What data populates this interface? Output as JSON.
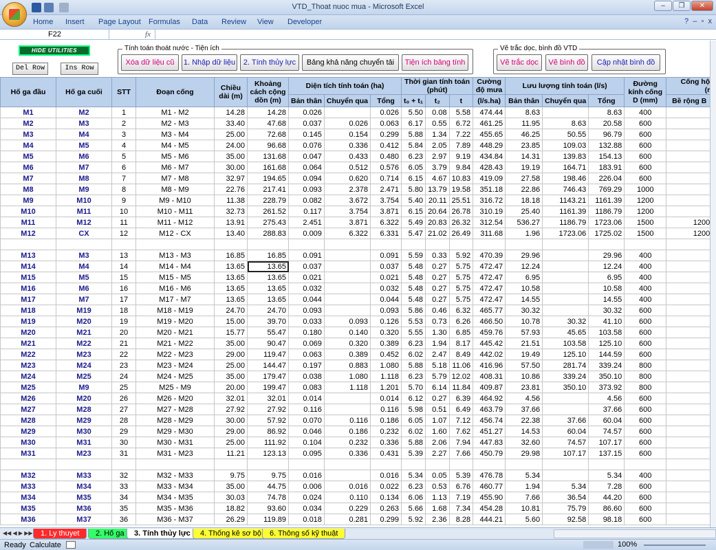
{
  "window": {
    "title": "VTD_Thoat nuoc mua - Microsoft Excel"
  },
  "ribbon": {
    "tabs": [
      "Home",
      "Insert",
      "Page Layout",
      "Formulas",
      "Data",
      "Review",
      "View",
      "Developer"
    ]
  },
  "formula": {
    "cell": "F22",
    "fx": "fx"
  },
  "utilities": {
    "hide_label": "HIDE UTILITIES",
    "del_row": "Del Row",
    "ins_row": "Ins Row",
    "group1_label": "Tính toán thoát nước - Tiện ích",
    "group1_buttons": [
      "Xóa dữ liệu cũ",
      "1. Nhập dữ liệu",
      "2. Tính thủy lực",
      "Bảng khả năng chuyển tải",
      "Tiện ích bảng tính"
    ],
    "group2_label": "Vẽ trắc dọc, bình đồ VTD",
    "group2_buttons": [
      "Vẽ trắc dọc",
      "Vẽ bình đồ",
      "Cập nhật bình đồ"
    ],
    "button_colors": [
      "#d4007a",
      "#1a1ab8",
      "#1a1ab8",
      "#000000",
      "#d4007a",
      "#d4007a",
      "#d4007a",
      "#1a1ab8"
    ]
  },
  "header": {
    "h1": "Hố ga đầu",
    "h2": "Hố ga cuối",
    "h3": "STT",
    "h4": "Đoạn cống",
    "h5": "Chiều dài (m)",
    "h6": "Khoảng cách cộng dồn (m)",
    "area": "Diện tích tính toán (ha)",
    "area_sub": [
      "Bản thân",
      "Chuyển qua",
      "Tổng"
    ],
    "time": "Thời gian tính toán (phút)",
    "time_sub": [
      "t₀ + t₁",
      "t₂",
      "t"
    ],
    "intensity": "Cường độ mưa",
    "intensity_unit": "(l/s.ha)",
    "flow": "Lưu lượng tính toán (l/s)",
    "flow_sub": [
      "Bản thân",
      "Chuyển qua",
      "Tổng"
    ],
    "diam": "Đường kính cống D (mm)",
    "box": "Cống hộ",
    "box_unit": "(r",
    "box_sub": "Bề rộng B"
  },
  "rows": [
    [
      "M1",
      "M2",
      "1",
      "M1 - M2",
      "14.28",
      "14.28",
      "0.026",
      "",
      "0.026",
      "5.50",
      "0.08",
      "5.58",
      "474.44",
      "8.63",
      "",
      "8.63",
      "400",
      ""
    ],
    [
      "M2",
      "M3",
      "2",
      "M2 - M3",
      "33.40",
      "47.68",
      "0.037",
      "0.026",
      "0.063",
      "6.17",
      "0.55",
      "6.72",
      "461.25",
      "11.95",
      "8.63",
      "20.58",
      "600",
      ""
    ],
    [
      "M3",
      "M4",
      "3",
      "M3 - M4",
      "25.00",
      "72.68",
      "0.145",
      "0.154",
      "0.299",
      "5.88",
      "1.34",
      "7.22",
      "455.65",
      "46.25",
      "50.55",
      "96.79",
      "600",
      ""
    ],
    [
      "M4",
      "M5",
      "4",
      "M4 - M5",
      "24.00",
      "96.68",
      "0.076",
      "0.336",
      "0.412",
      "5.84",
      "2.05",
      "7.89",
      "448.29",
      "23.85",
      "109.03",
      "132.88",
      "600",
      ""
    ],
    [
      "M5",
      "M6",
      "5",
      "M5 - M6",
      "35.00",
      "131.68",
      "0.047",
      "0.433",
      "0.480",
      "6.23",
      "2.97",
      "9.19",
      "434.84",
      "14.31",
      "139.83",
      "154.13",
      "600",
      ""
    ],
    [
      "M6",
      "M7",
      "6",
      "M6 - M7",
      "30.00",
      "161.68",
      "0.064",
      "0.512",
      "0.576",
      "6.05",
      "3.79",
      "9.84",
      "428.43",
      "19.19",
      "164.71",
      "183.91",
      "600",
      ""
    ],
    [
      "M7",
      "M8",
      "7",
      "M7 - M8",
      "32.97",
      "194.65",
      "0.094",
      "0.620",
      "0.714",
      "6.15",
      "4.67",
      "10.83",
      "419.09",
      "27.58",
      "198.46",
      "226.04",
      "600",
      ""
    ],
    [
      "M8",
      "M9",
      "8",
      "M8 - M9",
      "22.76",
      "217.41",
      "0.093",
      "2.378",
      "2.471",
      "5.80",
      "13.79",
      "19.58",
      "351.18",
      "22.86",
      "746.43",
      "769.29",
      "1000",
      ""
    ],
    [
      "M9",
      "M10",
      "9",
      "M9 - M10",
      "11.38",
      "228.79",
      "0.082",
      "3.672",
      "3.754",
      "5.40",
      "20.11",
      "25.51",
      "316.72",
      "18.18",
      "1143.21",
      "1161.39",
      "1200",
      ""
    ],
    [
      "M10",
      "M11",
      "10",
      "M10 - M11",
      "32.73",
      "261.52",
      "0.117",
      "3.754",
      "3.871",
      "6.15",
      "20.64",
      "26.78",
      "310.19",
      "25.40",
      "1161.39",
      "1186.79",
      "1200",
      ""
    ],
    [
      "M11",
      "M12",
      "11",
      "M11 - M12",
      "13.91",
      "275.43",
      "2.451",
      "3.871",
      "6.322",
      "5.49",
      "20.83",
      "26.32",
      "312.54",
      "536.27",
      "1186.79",
      "1723.06",
      "1500",
      "1200"
    ],
    [
      "M12",
      "CX",
      "12",
      "M12 - CX",
      "13.40",
      "288.83",
      "0.009",
      "6.322",
      "6.331",
      "5.47",
      "21.02",
      "26.49",
      "311.68",
      "1.96",
      "1723.06",
      "1725.02",
      "1500",
      "1200"
    ],
    [
      "",
      "",
      "",
      "",
      "",
      "",
      "",
      "",
      "",
      "",
      "",
      "",
      "",
      "",
      "",
      "",
      "",
      ""
    ],
    [
      "M13",
      "M3",
      "13",
      "M13 - M3",
      "16.85",
      "16.85",
      "0.091",
      "",
      "0.091",
      "5.59",
      "0.33",
      "5.92",
      "470.39",
      "29.96",
      "",
      "29.96",
      "400",
      ""
    ],
    [
      "M14",
      "M4",
      "14",
      "M14 - M4",
      "13.65",
      "13.65",
      "0.037",
      "",
      "0.037",
      "5.48",
      "0.27",
      "5.75",
      "472.47",
      "12.24",
      "",
      "12.24",
      "400",
      ""
    ],
    [
      "M15",
      "M5",
      "15",
      "M15 - M5",
      "13.65",
      "13.65",
      "0.021",
      "",
      "0.021",
      "5.48",
      "0.27",
      "5.75",
      "472.47",
      "6.95",
      "",
      "6.95",
      "400",
      ""
    ],
    [
      "M16",
      "M6",
      "16",
      "M16 - M6",
      "13.65",
      "13.65",
      "0.032",
      "",
      "0.032",
      "5.48",
      "0.27",
      "5.75",
      "472.47",
      "10.58",
      "",
      "10.58",
      "400",
      ""
    ],
    [
      "M17",
      "M7",
      "17",
      "M17 - M7",
      "13.65",
      "13.65",
      "0.044",
      "",
      "0.044",
      "5.48",
      "0.27",
      "5.75",
      "472.47",
      "14.55",
      "",
      "14.55",
      "400",
      ""
    ],
    [
      "M18",
      "M19",
      "18",
      "M18 - M19",
      "24.70",
      "24.70",
      "0.093",
      "",
      "0.093",
      "5.86",
      "0.46",
      "6.32",
      "465.77",
      "30.32",
      "",
      "30.32",
      "600",
      ""
    ],
    [
      "M19",
      "M20",
      "19",
      "M19 - M20",
      "15.00",
      "39.70",
      "0.033",
      "0.093",
      "0.126",
      "5.53",
      "0.73",
      "6.26",
      "466.50",
      "10.78",
      "30.32",
      "41.10",
      "600",
      ""
    ],
    [
      "M20",
      "M21",
      "20",
      "M20 - M21",
      "15.77",
      "55.47",
      "0.180",
      "0.140",
      "0.320",
      "5.55",
      "1.30",
      "6.85",
      "459.76",
      "57.93",
      "45.65",
      "103.58",
      "600",
      ""
    ],
    [
      "M21",
      "M22",
      "21",
      "M21 - M22",
      "35.00",
      "90.47",
      "0.069",
      "0.320",
      "0.389",
      "6.23",
      "1.94",
      "8.17",
      "445.42",
      "21.51",
      "103.58",
      "125.10",
      "600",
      ""
    ],
    [
      "M22",
      "M23",
      "22",
      "M22 - M23",
      "29.00",
      "119.47",
      "0.063",
      "0.389",
      "0.452",
      "6.02",
      "2.47",
      "8.49",
      "442.02",
      "19.49",
      "125.10",
      "144.59",
      "600",
      ""
    ],
    [
      "M23",
      "M24",
      "23",
      "M23 - M24",
      "25.00",
      "144.47",
      "0.197",
      "0.883",
      "1.080",
      "5.88",
      "5.18",
      "11.06",
      "416.96",
      "57.50",
      "281.74",
      "339.24",
      "800",
      ""
    ],
    [
      "M24",
      "M25",
      "24",
      "M24 - M25",
      "35.00",
      "179.47",
      "0.038",
      "1.080",
      "1.118",
      "6.23",
      "5.79",
      "12.02",
      "408.31",
      "10.86",
      "339.24",
      "350.10",
      "800",
      ""
    ],
    [
      "M25",
      "M9",
      "25",
      "M25 - M9",
      "20.00",
      "199.47",
      "0.083",
      "1.118",
      "1.201",
      "5.70",
      "6.14",
      "11.84",
      "409.87",
      "23.81",
      "350.10",
      "373.92",
      "800",
      ""
    ],
    [
      "M26",
      "M20",
      "26",
      "M26 - M20",
      "32.01",
      "32.01",
      "0.014",
      "",
      "0.014",
      "6.12",
      "0.27",
      "6.39",
      "464.92",
      "4.56",
      "",
      "4.56",
      "600",
      ""
    ],
    [
      "M27",
      "M28",
      "27",
      "M27 - M28",
      "27.92",
      "27.92",
      "0.116",
      "",
      "0.116",
      "5.98",
      "0.51",
      "6.49",
      "463.79",
      "37.66",
      "",
      "37.66",
      "600",
      ""
    ],
    [
      "M28",
      "M29",
      "28",
      "M28 - M29",
      "30.00",
      "57.92",
      "0.070",
      "0.116",
      "0.186",
      "6.05",
      "1.07",
      "7.12",
      "456.74",
      "22.38",
      "37.66",
      "60.04",
      "600",
      ""
    ],
    [
      "M29",
      "M30",
      "29",
      "M29 - M30",
      "29.00",
      "86.92",
      "0.046",
      "0.186",
      "0.232",
      "6.02",
      "1.60",
      "7.62",
      "451.27",
      "14.53",
      "60.04",
      "74.57",
      "600",
      ""
    ],
    [
      "M30",
      "M31",
      "30",
      "M30 - M31",
      "25.00",
      "111.92",
      "0.104",
      "0.232",
      "0.336",
      "5.88",
      "2.06",
      "7.94",
      "447.83",
      "32.60",
      "74.57",
      "107.17",
      "600",
      ""
    ],
    [
      "M31",
      "M23",
      "31",
      "M31 - M23",
      "11.21",
      "123.13",
      "0.095",
      "0.336",
      "0.431",
      "5.39",
      "2.27",
      "7.66",
      "450.79",
      "29.98",
      "107.17",
      "137.15",
      "600",
      ""
    ],
    [
      "",
      "",
      "",
      "",
      "",
      "",
      "",
      "",
      "",
      "",
      "",
      "",
      "",
      "",
      "",
      "",
      "",
      ""
    ],
    [
      "M32",
      "M33",
      "32",
      "M32 - M33",
      "9.75",
      "9.75",
      "0.016",
      "",
      "0.016",
      "5.34",
      "0.05",
      "5.39",
      "476.78",
      "5.34",
      "",
      "5.34",
      "400",
      ""
    ],
    [
      "M33",
      "M34",
      "33",
      "M33 - M34",
      "35.00",
      "44.75",
      "0.006",
      "0.016",
      "0.022",
      "6.23",
      "0.53",
      "6.76",
      "460.77",
      "1.94",
      "5.34",
      "7.28",
      "600",
      ""
    ],
    [
      "M34",
      "M35",
      "34",
      "M34 - M35",
      "30.03",
      "74.78",
      "0.024",
      "0.110",
      "0.134",
      "6.06",
      "1.13",
      "7.19",
      "455.90",
      "7.66",
      "36.54",
      "44.20",
      "600",
      ""
    ],
    [
      "M35",
      "M36",
      "35",
      "M35 - M36",
      "18.82",
      "93.60",
      "0.034",
      "0.229",
      "0.263",
      "5.66",
      "1.68",
      "7.34",
      "454.28",
      "10.81",
      "75.79",
      "86.60",
      "600",
      ""
    ],
    [
      "M36",
      "M37",
      "36",
      "M36 - M37",
      "26.29",
      "119.89",
      "0.018",
      "0.281",
      "0.299",
      "5.92",
      "2.36",
      "8.28",
      "444.21",
      "5.60",
      "92.58",
      "98.18",
      "600",
      ""
    ]
  ],
  "sheet_tabs": [
    {
      "label": "1. Ly thuyet",
      "bg": "#ff2a2a",
      "color": "#ffffff"
    },
    {
      "label": "2. Hố ga",
      "bg": "#33ff66",
      "color": "#000000"
    },
    {
      "label": "3. Tính thủy lực",
      "bg": "#ffffff",
      "color": "#000000"
    },
    {
      "label": "4. Thống kê sơ bộ",
      "bg": "#ffff33",
      "color": "#000000"
    },
    {
      "label": "6. Thông số kỹ thuật",
      "bg": "#ffff33",
      "color": "#000000"
    }
  ],
  "status": {
    "ready": "Ready",
    "calculate": "Calculate",
    "zoom": "100%"
  }
}
